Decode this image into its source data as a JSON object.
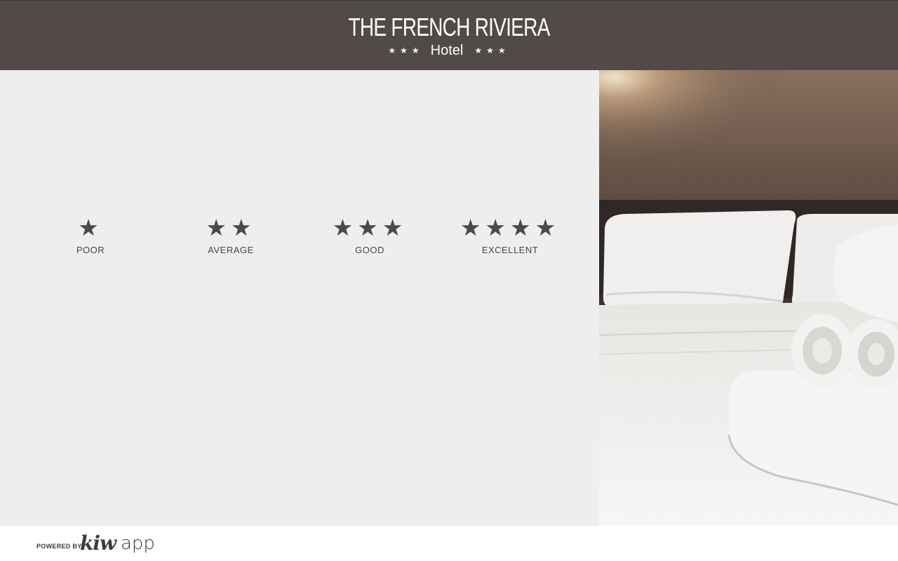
{
  "header": {
    "title": "THE FRENCH RIVIERA",
    "subtitle": "Hotel",
    "stars_left": "★★★",
    "stars_right": "★★★"
  },
  "ratings": [
    {
      "stars": "★",
      "label": "POOR"
    },
    {
      "stars": "★★",
      "label": "AVERAGE"
    },
    {
      "stars": "★★★",
      "label": "GOOD"
    },
    {
      "stars": "★★★★",
      "label": "EXCELLENT"
    }
  ],
  "footer": {
    "powered_by": "POWERED BY",
    "brand_bold": "kiw",
    "brand_light": "app"
  },
  "colors": {
    "header_bg": "#524a48",
    "panel_bg": "#eeeeee",
    "star_color": "#4e4846"
  }
}
